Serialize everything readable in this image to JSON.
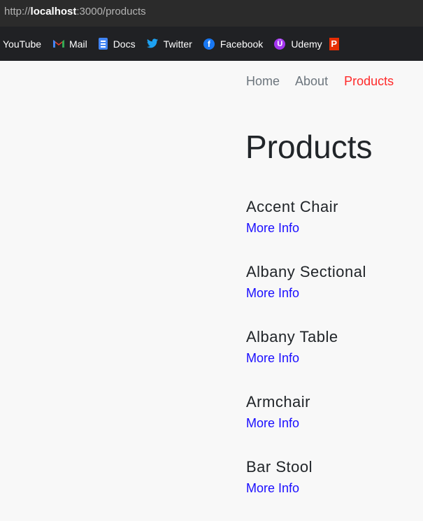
{
  "browser": {
    "url_prefix": "http://",
    "url_host": "localhost",
    "url_rest": ":3000/products",
    "bookmarks": [
      {
        "label": "YouTube",
        "icon": "none"
      },
      {
        "label": "Mail",
        "icon": "gmail-icon"
      },
      {
        "label": "Docs",
        "icon": "docs-icon"
      },
      {
        "label": "Twitter",
        "icon": "twitter-icon"
      },
      {
        "label": "Facebook",
        "icon": "facebook-icon"
      },
      {
        "label": "Udemy",
        "icon": "udemy-icon"
      },
      {
        "label": "",
        "icon": "pinterest-like-icon"
      }
    ]
  },
  "nav": {
    "home": "Home",
    "about": "About",
    "products": "Products",
    "active_color": "#ff2a2a"
  },
  "page": {
    "title": "Products"
  },
  "products": [
    {
      "name": "Accent Chair",
      "link": "More Info"
    },
    {
      "name": "Albany Sectional",
      "link": "More Info"
    },
    {
      "name": "Albany Table",
      "link": "More Info"
    },
    {
      "name": "Armchair",
      "link": "More Info"
    },
    {
      "name": "Bar Stool",
      "link": "More Info"
    }
  ]
}
